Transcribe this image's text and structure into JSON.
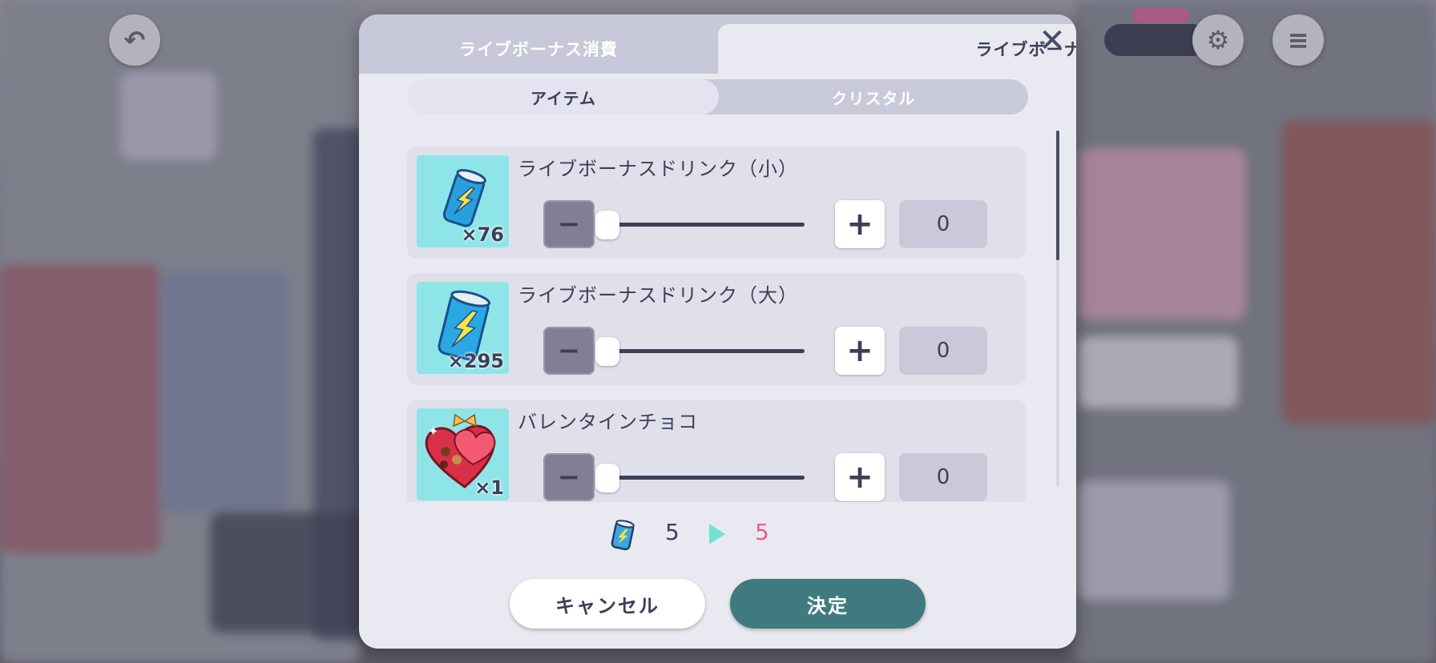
{
  "tabs": [
    {
      "label": "ライブボーナス消費",
      "active": false
    },
    {
      "label": "ライブボーナス回復",
      "active": true
    }
  ],
  "subtabs": [
    {
      "label": "アイテム",
      "active": true
    },
    {
      "label": "クリスタル",
      "active": false
    }
  ],
  "items": [
    {
      "name": "ライブボーナスドリンク（小）",
      "count": "×76",
      "quantity": "0",
      "icon": "drink-can-small-icon"
    },
    {
      "name": "ライブボーナスドリンク（大）",
      "count": "×295",
      "quantity": "0",
      "icon": "drink-can-large-icon"
    },
    {
      "name": "バレンタインチョコ",
      "count": "×1",
      "quantity": "0",
      "icon": "valentine-chocolate-icon"
    }
  ],
  "summary": {
    "from": "5",
    "to": "5"
  },
  "buttons": {
    "cancel": "キャンセル",
    "confirm": "決定"
  },
  "colors": {
    "accent": "#3f7a7f",
    "highlight": "#f2578d",
    "arrow": "#74e0d8",
    "text": "#3d3f59"
  }
}
